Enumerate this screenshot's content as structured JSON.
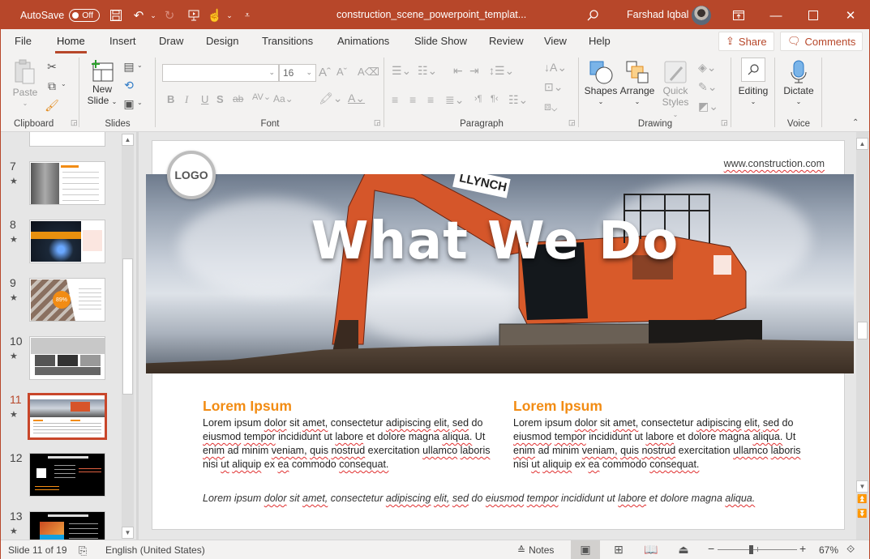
{
  "titlebar": {
    "autosave_label": "AutoSave",
    "autosave_state": "Off",
    "filename": "construction_scene_powerpoint_templat...",
    "user_name": "Farshad Iqbal"
  },
  "menu": {
    "tabs": [
      "File",
      "Home",
      "Insert",
      "Draw",
      "Design",
      "Transitions",
      "Animations",
      "Slide Show",
      "Review",
      "View",
      "Help"
    ],
    "active_tab": "Home",
    "share_label": "Share",
    "comments_label": "Comments"
  },
  "ribbon": {
    "clipboard": {
      "label": "Clipboard",
      "paste_label": "Paste"
    },
    "slides": {
      "label": "Slides",
      "new_slide_line1": "New",
      "new_slide_line2": "Slide"
    },
    "font": {
      "label": "Font",
      "font_name": "",
      "font_size": "16"
    },
    "paragraph": {
      "label": "Paragraph"
    },
    "drawing": {
      "label": "Drawing",
      "shapes_label": "Shapes",
      "arrange_label": "Arrange",
      "quick_styles_line1": "Quick",
      "quick_styles_line2": "Styles"
    },
    "editing": {
      "label": "Editing"
    },
    "voice": {
      "label": "Voice",
      "dictate_label": "Dictate"
    }
  },
  "thumbnails": {
    "items": [
      {
        "number": "7",
        "has_animation": true
      },
      {
        "number": "8",
        "has_animation": true
      },
      {
        "number": "9",
        "has_animation": true,
        "badge": "89%"
      },
      {
        "number": "10",
        "has_animation": true
      },
      {
        "number": "11",
        "has_animation": true,
        "selected": true
      },
      {
        "number": "12",
        "has_animation": false
      },
      {
        "number": "13",
        "has_animation": true
      }
    ]
  },
  "slide": {
    "logo": "LOGO",
    "url": "www.construction.com",
    "title": "What We Do",
    "columns": [
      {
        "heading": "Lorem Ipsum",
        "body": "Lorem ipsum dolor sit amet, consectetur adipiscing elit, sed do eiusmod tempor incididunt ut labore et dolore magna aliqua. Ut enim ad minim veniam, quis nostrud exercitation ullamco laboris nisi ut aliquip ex ea commodo consequat."
      },
      {
        "heading": "Lorem Ipsum",
        "body": "Lorem ipsum dolor sit amet, consectetur adipiscing elit, sed do eiusmod tempor incididunt ut labore et dolore magna aliqua. Ut enim ad minim veniam, quis nostrud exercitation ullamco laboris nisi ut aliquip ex ea commodo consequat."
      }
    ],
    "footer_text": "Lorem ipsum dolor sit amet, consectetur adipiscing elit, sed do eiusmod tempor incididunt ut labore et dolore magna aliqua."
  },
  "statusbar": {
    "slide_indicator": "Slide 11 of 19",
    "language": "English (United States)",
    "notes_label": "Notes",
    "zoom_level": "67%",
    "zoom_fraction": 0.42
  },
  "colors": {
    "accent": "#b7472a",
    "heading_orange": "#f28c14"
  }
}
